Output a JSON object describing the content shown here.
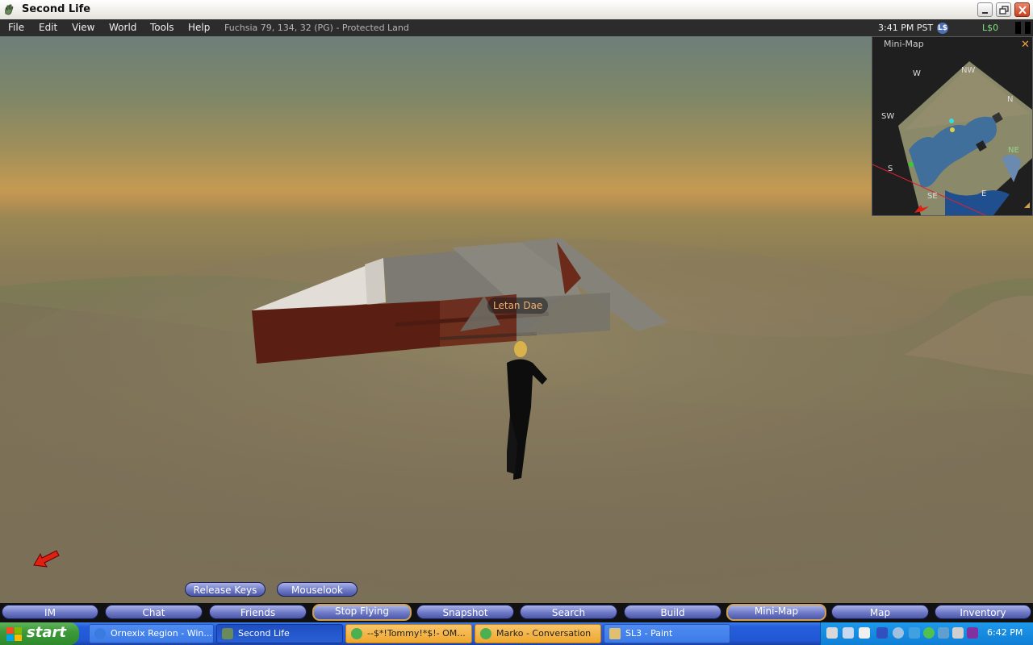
{
  "window": {
    "title": "Second Life",
    "icons": [
      "second-life-hand-icon"
    ],
    "buttons": [
      "minimize",
      "restore",
      "close"
    ]
  },
  "menu": {
    "items": [
      "File",
      "Edit",
      "View",
      "World",
      "Tools",
      "Help"
    ],
    "location": "Fuchsia 79, 134, 32 (PG) - Protected Land",
    "time": "3:41 PM PST",
    "currency_icon": "L$",
    "balance": "L$0"
  },
  "scene": {
    "nametag": "Letan Dae"
  },
  "minimap": {
    "title": "Mini-Map",
    "close_glyph": "✕",
    "directions": {
      "w": "W",
      "nw": "NW",
      "n": "N",
      "sw": "SW",
      "ne": "NE",
      "s": "S",
      "se": "SE",
      "e": "E"
    }
  },
  "overlay_buttons": {
    "release_keys": "Release Keys",
    "mouselook": "Mouselook"
  },
  "toolbar": {
    "buttons": [
      "IM",
      "Chat",
      "Friends",
      "Stop Flying",
      "Snapshot",
      "Search",
      "Build",
      "Mini-Map",
      "Map",
      "Inventory"
    ]
  },
  "taskbar": {
    "start": "start",
    "tasks": [
      "Ornexix Region - Win...",
      "Second Life",
      "--$*!Tommy!*$!- OM...",
      "Marko - Conversation",
      "SL3 - Paint"
    ],
    "clock": "6:42 PM"
  },
  "colors": {
    "menubar": "#2c2c2c",
    "pill_button": "#6e79c6",
    "active_outline": "#d0a050",
    "taskbar": "#245edb",
    "start_green": "#3c9a39"
  }
}
